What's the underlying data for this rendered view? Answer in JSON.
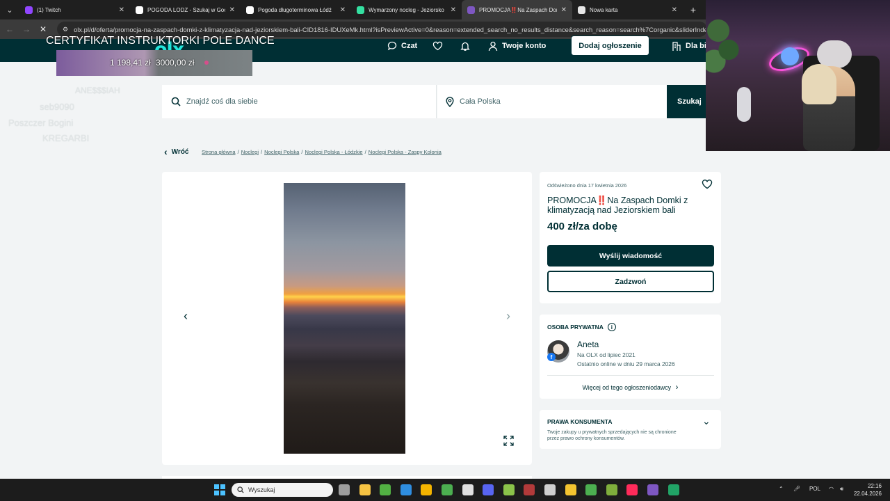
{
  "browser": {
    "tabs": [
      {
        "title": "(1) Twitch",
        "favicon_color": "#9146ff",
        "active": false
      },
      {
        "title": "POGODA LODZ - Szukaj w Google",
        "favicon_color": "#ffffff",
        "active": false
      },
      {
        "title": "Pogoda długoterminowa Łódź",
        "favicon_color": "#ffffff",
        "active": false
      },
      {
        "title": "Wymarzony nocleg - Jeziorsko",
        "favicon_color": "#34e0a1",
        "active": false
      },
      {
        "title": "PROMOCJA‼️Na Zaspach Domki",
        "favicon_color": "#7e57c2",
        "active": true
      },
      {
        "title": "Nowa karta",
        "favicon_color": "#e6e6e6",
        "active": false
      }
    ],
    "tab_close": "✕",
    "new_tab": "+",
    "url": "olx.pl/d/oferta/promocja-na-zaspach-domki-z-klimatyzacja-nad-jeziorskiem-bali-CID1816-IDUXeMk.html?isPreviewActive=0&reason=extended_search_no_results_distance&search_reason=search%7Corganic&sliderIndex="
  },
  "header": {
    "logo": "olx",
    "chat": "Czat",
    "account": "Twoje konto",
    "post_ad": "Dodaj ogłoszenie",
    "business": "Dla bi"
  },
  "overlay": {
    "title": "CERTYFIKAT INSTRUKTORKI POLE DANCE",
    "current": "1 198,41 zł",
    "goal": "3000,00 zł",
    "progress": 0.4,
    "ghost_lines": [
      "ANE$$$IAH",
      "seb9090",
      "Poszczer Bogini",
      "KREGARBI"
    ]
  },
  "search": {
    "placeholder": "Znajdź coś dla siebie",
    "location": "Cała Polska",
    "button": "Szukaj"
  },
  "breadcrumb": {
    "back": "Wróć",
    "items": [
      "Strona główna",
      "Noclegi",
      "Noclegi Polska",
      "Noclegi Polska - Łódzkie",
      "Noclegi Polska - Zaspy Kolonia"
    ]
  },
  "ad": {
    "refreshed": "Odświeżono dnia 17 kwietnia 2026",
    "title": "PROMOCJA‼️Na Zaspach Domki z klimatyzacją nad Jeziorskiem bali",
    "price": "400 zł/za dobę",
    "message_button": "Wyślij wiadomość",
    "call_button": "Zadzwoń"
  },
  "seller": {
    "header": "OSOBA PRYWATNA",
    "name": "Aneta",
    "since": "Na OLX od lipiec 2021",
    "online": "Ostatnio online w dniu 29 marca 2026",
    "more": "Więcej od tego ogłoszeniodawcy"
  },
  "consumer_rights": {
    "header": "PRAWA KONSUMENTA",
    "text": "Twoje zakupy u prywatnych sprzedających nie są chronione przez prawo ochrony konsumentów."
  },
  "taskbar": {
    "search": "Wyszukaj",
    "language": "POL",
    "time": "22:16",
    "date": "22.04.2026",
    "icons": [
      {
        "name": "task-view-icon",
        "color": "#9e9e9e"
      },
      {
        "name": "file-explorer-icon",
        "color": "#f6c343"
      },
      {
        "name": "xbox-icon",
        "color": "#52b043"
      },
      {
        "name": "vscode-icon",
        "color": "#2f8ee0"
      },
      {
        "name": "git-icon",
        "color": "#f4b400"
      },
      {
        "name": "chrome-icon",
        "color": "#4caf50"
      },
      {
        "name": "app-icon",
        "color": "#e0e0e0"
      },
      {
        "name": "discord-icon",
        "color": "#5865f2"
      },
      {
        "name": "notepad-icon",
        "color": "#8bc34a"
      },
      {
        "name": "davinci-icon",
        "color": "#b23a3a"
      },
      {
        "name": "obs-icon",
        "color": "#cfcfcf"
      },
      {
        "name": "epic-icon",
        "color": "#f4c430"
      },
      {
        "name": "minecraft-icon",
        "color": "#4caf50"
      },
      {
        "name": "game-icon",
        "color": "#7fae3c"
      },
      {
        "name": "tiktok-icon",
        "color": "#ff2b5a"
      },
      {
        "name": "browser-active-icon",
        "color": "#7e57c2"
      },
      {
        "name": "excel-icon",
        "color": "#21a366"
      }
    ]
  }
}
